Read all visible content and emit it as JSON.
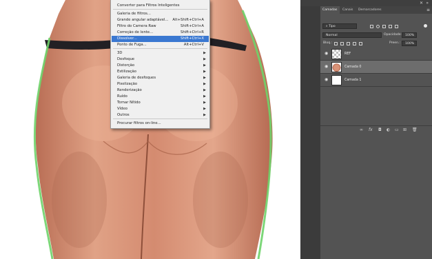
{
  "filter_menu": {
    "items": [
      {
        "label": "Converter para Filtros Inteligentes",
        "shortcut": "",
        "submenu": false
      },
      {
        "label": "Galeria de filtros...",
        "shortcut": "",
        "submenu": false
      },
      {
        "label": "Grande angular adaptável...",
        "shortcut": "Alt+Shift+Ctrl+A",
        "submenu": false
      },
      {
        "label": "Filtro do Camera Raw",
        "shortcut": "Shift+Ctrl+A",
        "submenu": false
      },
      {
        "label": "Correção de lente...",
        "shortcut": "Shift+Ctrl+R",
        "submenu": false
      },
      {
        "label": "Dissolver...",
        "shortcut": "Shift+Ctrl+X",
        "submenu": false
      },
      {
        "label": "Ponto de Fuga...",
        "shortcut": "Alt+Ctrl+V",
        "submenu": false
      },
      {
        "label": "3D",
        "shortcut": "",
        "submenu": true
      },
      {
        "label": "Desfoque",
        "shortcut": "",
        "submenu": true
      },
      {
        "label": "Distorção",
        "shortcut": "",
        "submenu": true
      },
      {
        "label": "Estilização",
        "shortcut": "",
        "submenu": true
      },
      {
        "label": "Galeria de desfoques",
        "shortcut": "",
        "submenu": true
      },
      {
        "label": "Pixelização",
        "shortcut": "",
        "submenu": true
      },
      {
        "label": "Renderização",
        "shortcut": "",
        "submenu": true
      },
      {
        "label": "Ruído",
        "shortcut": "",
        "submenu": true
      },
      {
        "label": "Tornar Nítido",
        "shortcut": "",
        "submenu": true
      },
      {
        "label": "Vídeo",
        "shortcut": "",
        "submenu": true
      },
      {
        "label": "Outros",
        "shortcut": "",
        "submenu": true
      },
      {
        "label": "Procurar filtros on-line...",
        "shortcut": "",
        "submenu": false
      }
    ],
    "highlighted": "Dissolver..."
  },
  "panel": {
    "tabs": [
      "Camadas",
      "Canais",
      "Demarcadores"
    ],
    "active_tab": "Camadas",
    "filter_kind": "Tipo",
    "blend_mode": "Normal",
    "opacity_label": "Opacidade:",
    "opacity_value": "100%",
    "lock_label": "Bloq.:",
    "fill_label": "Preen.:",
    "fill_value": "100%",
    "layers": [
      {
        "name": "REF",
        "selected": false,
        "visible": true,
        "thumb": "checker"
      },
      {
        "name": "Camada 0",
        "selected": true,
        "visible": true,
        "thumb": "photo"
      },
      {
        "name": "Camada 1",
        "selected": false,
        "visible": true,
        "thumb": "white"
      }
    ],
    "bottom_icons": [
      "link-icon",
      "fx-icon",
      "mask-icon",
      "adjustment-icon",
      "group-folder-icon",
      "new-layer-icon",
      "trash-icon"
    ]
  },
  "colors": {
    "menu_highlight": "#3a78d1",
    "panel_bg": "#535353",
    "selected_layer": "#6d6d6d",
    "skin": "#d99378",
    "outline": "#6fd36a"
  }
}
